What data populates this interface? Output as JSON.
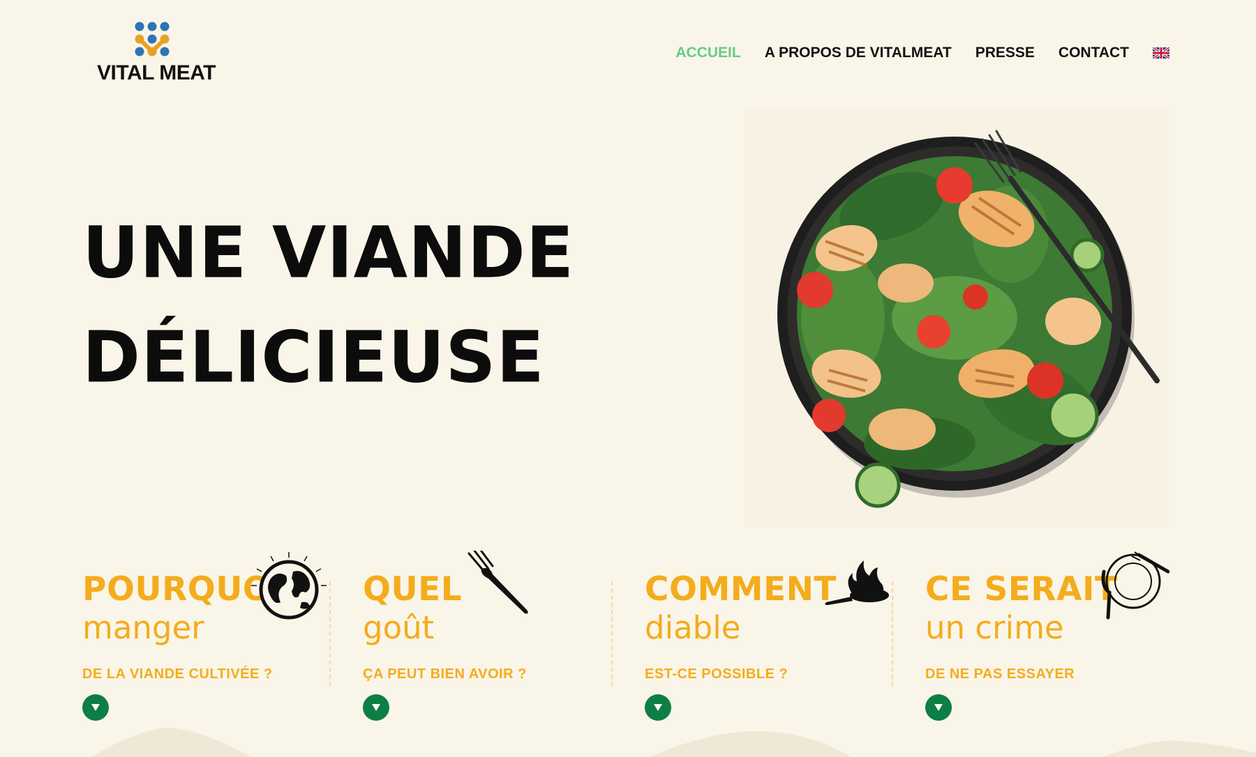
{
  "header": {
    "logo_text": "VITAL MEAT",
    "nav": [
      {
        "label": "ACCUEIL",
        "active": true
      },
      {
        "label": "A PROPOS DE VITALMEAT",
        "active": false
      },
      {
        "label": "PRESSE",
        "active": false
      },
      {
        "label": "CONTACT",
        "active": false
      }
    ],
    "language_icon": "uk-flag-icon"
  },
  "hero": {
    "line1": "UNE VIANDE",
    "line2": "DÉLICIEUSE",
    "image": "salad-bowl-with-grilled-chicken"
  },
  "features": [
    {
      "title": "POURQUOI",
      "subtitle": "manger",
      "question": "DE LA VIANDE CULTIVÉE ?",
      "icon": "globe-icon"
    },
    {
      "title": "QUEL",
      "subtitle": "goût",
      "question": "ÇA PEUT BIEN AVOIR ?",
      "icon": "fork-icon"
    },
    {
      "title": "COMMENT",
      "subtitle": "diable",
      "question": "EST-CE POSSIBLE ?",
      "icon": "flaming-pan-icon"
    },
    {
      "title": "CE SERAIT",
      "subtitle": "un crime",
      "question": "DE NE PAS ESSAYER",
      "icon": "plate-cutlery-icon"
    }
  ],
  "colors": {
    "background": "#f9f5e8",
    "nav_active": "#66cc8a",
    "accent_yellow": "#f4ac1c",
    "button_green": "#0d7f44",
    "text_dark": "#111111"
  }
}
